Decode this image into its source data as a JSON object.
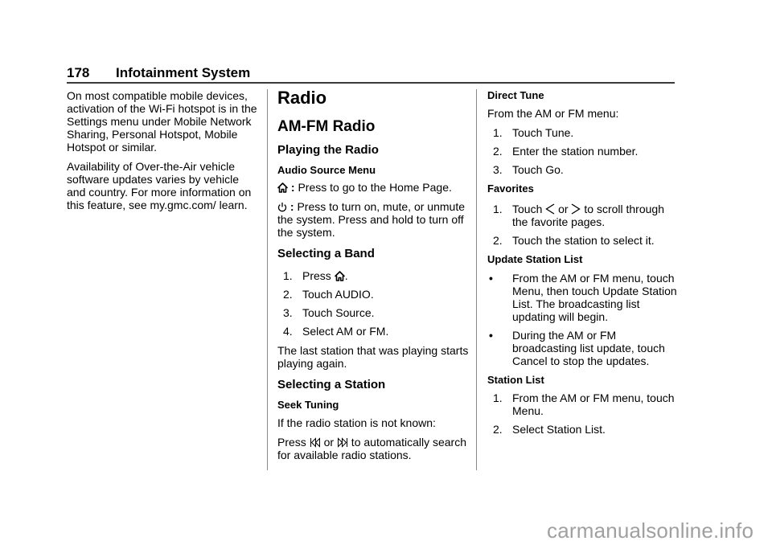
{
  "header": {
    "page_number": "178",
    "chapter_title": "Infotainment System"
  },
  "column1": {
    "paragraphs": [
      "On most compatible mobile devices, activation of the Wi-Fi hotspot is in the Settings menu under Mobile Network Sharing, Personal Hotspot, Mobile Hotspot or similar.",
      "Availability of Over-the-Air vehicle software updates varies by vehicle and country. For more information on this feature, see my.gmc.com/ learn."
    ]
  },
  "column2": {
    "title": "Radio",
    "section": "AM-FM Radio",
    "playing": {
      "heading": "Playing the Radio",
      "audio_source_heading": "Audio Source Menu",
      "home_item": {
        "icon": "home-icon",
        "separator": " : ",
        "text": "Press to go to the Home Page."
      },
      "power_item": {
        "icon": "power-icon",
        "separator": " : ",
        "text": "Press to turn on, mute, or unmute the system. Press and hold to turn off the system."
      }
    },
    "band": {
      "heading": "Selecting a Band",
      "steps": [
        {
          "num": "1.",
          "text_before": "Press ",
          "icon": "home-icon",
          "text_after": "."
        },
        {
          "num": "2.",
          "text": "Touch AUDIO."
        },
        {
          "num": "3.",
          "text": "Touch Source."
        },
        {
          "num": "4.",
          "text": "Select AM or FM."
        }
      ],
      "note": "The last station that was playing starts playing again."
    },
    "station": {
      "heading": "Selecting a Station",
      "seek_heading": "Seek Tuning",
      "seek_intro": "If the radio station is not known:",
      "seek_press": "Press ",
      "seek_or": " or ",
      "seek_rest": " to automatically search for available radio stations.",
      "seek_back_icon": "seek-back-icon",
      "seek_forward_icon": "seek-forward-icon"
    }
  },
  "column3": {
    "direct_tune": {
      "heading": "Direct Tune",
      "intro": "From the AM or FM menu:",
      "steps": [
        {
          "num": "1.",
          "text": "Touch Tune."
        },
        {
          "num": "2.",
          "text": "Enter the station number."
        },
        {
          "num": "3.",
          "text": "Touch Go."
        }
      ]
    },
    "favorites": {
      "heading": "Favorites",
      "step1": {
        "num": "1.",
        "touch": "Touch ",
        "or": " or ",
        "rest": " to scroll through the favorite pages."
      },
      "step2": {
        "num": "2.",
        "text": "Touch the station to select it."
      }
    },
    "update_list": {
      "heading": "Update Station List",
      "bullet": "•",
      "items": [
        "From the AM or FM menu, touch Menu, then touch Update Station List. The broadcasting list updating will begin.",
        "During the AM or FM broadcasting list update, touch Cancel to stop the updates."
      ]
    },
    "station_list": {
      "heading": "Station List",
      "steps": [
        {
          "num": "1.",
          "text": "From the AM or FM menu, touch Menu."
        },
        {
          "num": "2.",
          "text": "Select Station List."
        }
      ]
    }
  },
  "watermark": "carmanualsonline.info"
}
